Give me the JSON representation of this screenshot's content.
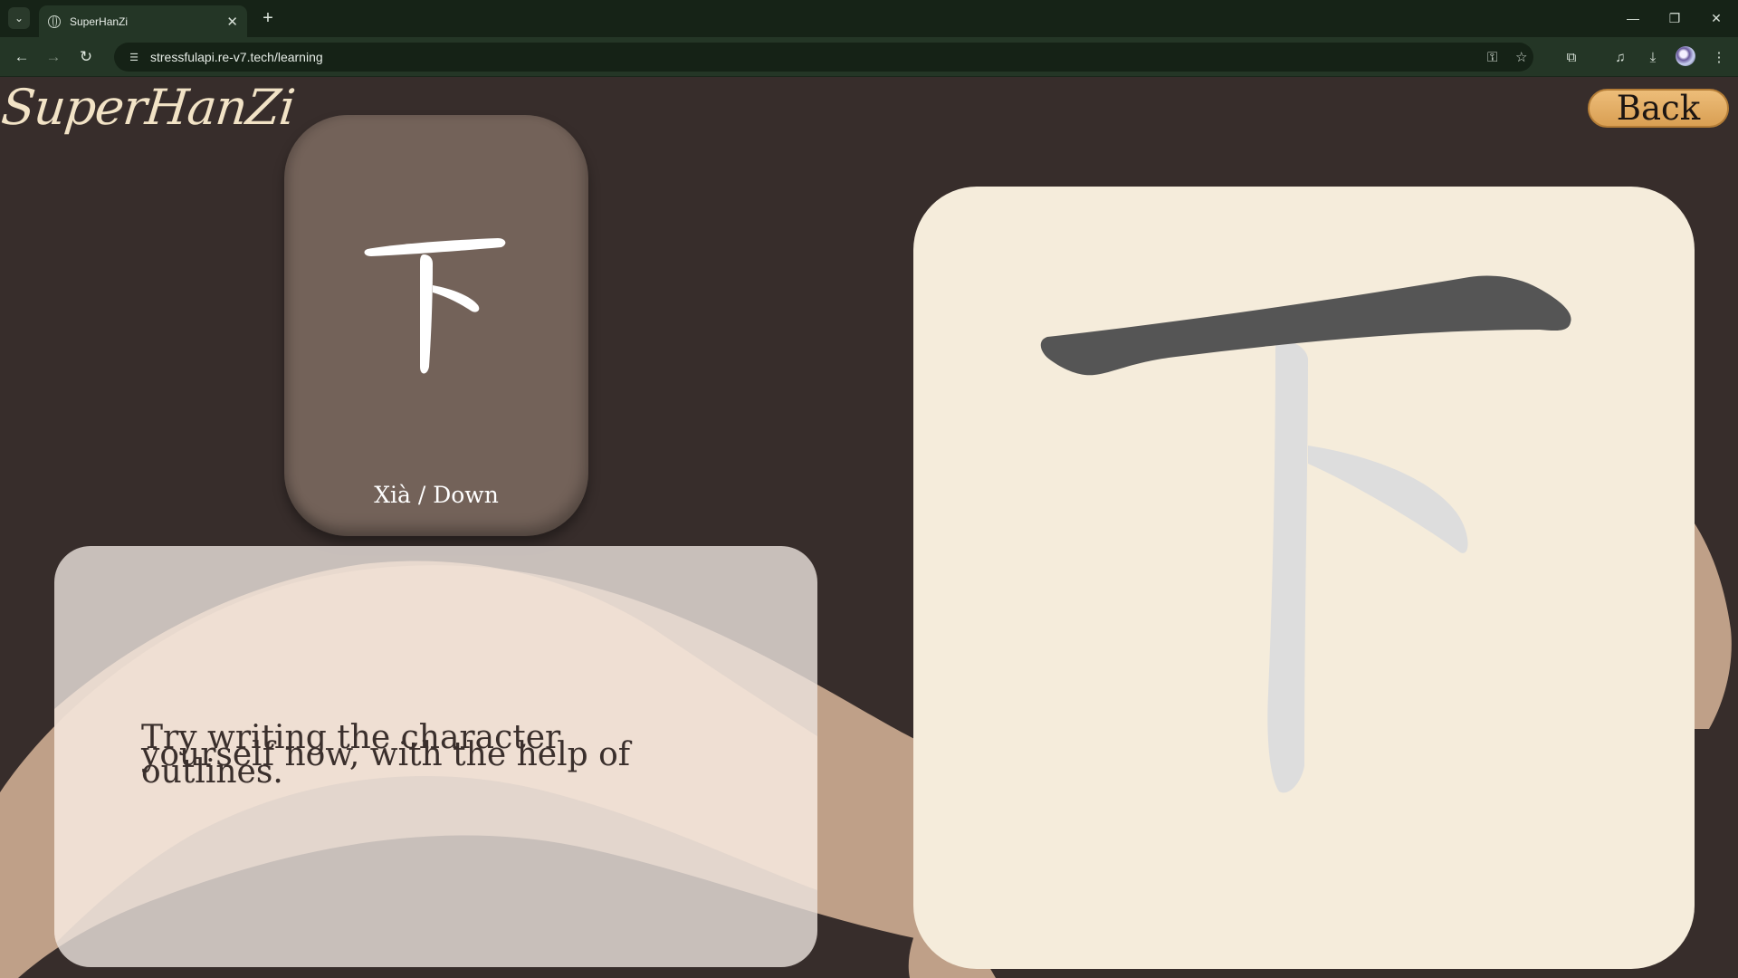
{
  "browser": {
    "tab_title": "SuperHanZi",
    "url": "stressfulapi.re-v7.tech/learning"
  },
  "app": {
    "logo_text": "SuperHanZi",
    "back_label": "Back"
  },
  "character": {
    "glyph": "下",
    "pinyin_meaning": "Xià / Down"
  },
  "instructions": {
    "text": "Try writing the character yourself now, with the help of outlines."
  },
  "writing_board": {
    "strokes_total": 3,
    "strokes_completed": 1
  },
  "colors": {
    "page_background": "#372d2b",
    "card": "#736259",
    "board": "#f5ecdb",
    "accent": "#e3ae66",
    "completed_stroke": "#555555",
    "outline_stroke": "#dddddd"
  }
}
